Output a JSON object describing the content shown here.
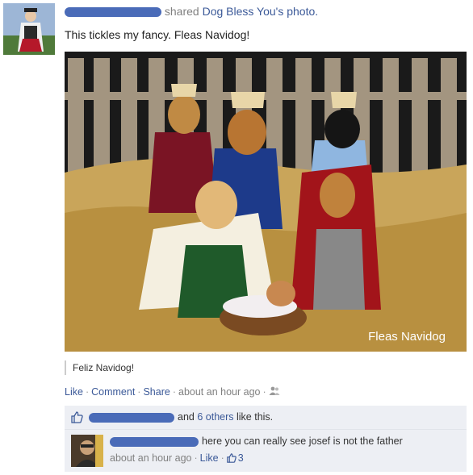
{
  "post": {
    "header_action": "shared",
    "shared_source": "Dog Bless You's photo.",
    "status_text": "This tickles my fancy. Fleas Navidog!",
    "photo_watermark": "Fleas Navidog",
    "caption": "Feliz Navidog!",
    "actions": {
      "like": "Like",
      "comment": "Comment",
      "share": "Share",
      "timestamp": "about an hour ago",
      "audience_icon": "friends-icon"
    }
  },
  "likes": {
    "connector": "and",
    "others_link": "6 others",
    "suffix": "like this.",
    "icon": "thumbs-up-icon"
  },
  "comment": {
    "text": "here you can really see josef is not the father",
    "timestamp": "about an hour ago",
    "like_label": "Like",
    "like_count": "3"
  },
  "colors": {
    "link": "#3b5998",
    "redaction": "#4a6bb8",
    "panel": "#edeff4"
  }
}
